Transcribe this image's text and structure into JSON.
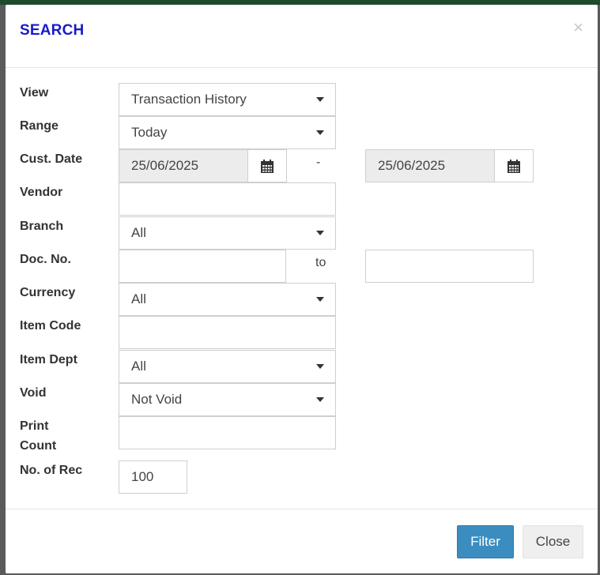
{
  "dialog": {
    "title": "SEARCH",
    "close_glyph": "×"
  },
  "labels": {
    "view": "View",
    "range": "Range",
    "cust_date": "Cust. Date",
    "vendor": "Vendor",
    "branch": "Branch",
    "doc_no": "Doc. No.",
    "currency": "Currency",
    "item_code": "Item Code",
    "item_dept": "Item Dept",
    "void": "Void",
    "print_count_line1": "Print",
    "print_count_line2": "Count",
    "no_of_rec": "No. of Rec"
  },
  "fields": {
    "view": "Transaction History",
    "range": "Today",
    "date_from": "25/06/2025",
    "date_to": "25/06/2025",
    "date_separator": "-",
    "vendor": "",
    "branch": "All",
    "doc_no_from": "",
    "doc_no_separator": "to",
    "doc_no_to": "",
    "currency": "All",
    "item_code": "",
    "item_dept": "All",
    "void": "Not Void",
    "print_count": "",
    "no_of_rec": "100"
  },
  "footer": {
    "filter_label": "Filter",
    "close_label": "Close"
  },
  "colors": {
    "title": "#1a1ac8",
    "filter_button": "#3b8dc0",
    "top_bar": "#1f4a2c"
  },
  "icons": {
    "calendar": "calendar-icon",
    "dropdown": "chevron-down-icon"
  }
}
